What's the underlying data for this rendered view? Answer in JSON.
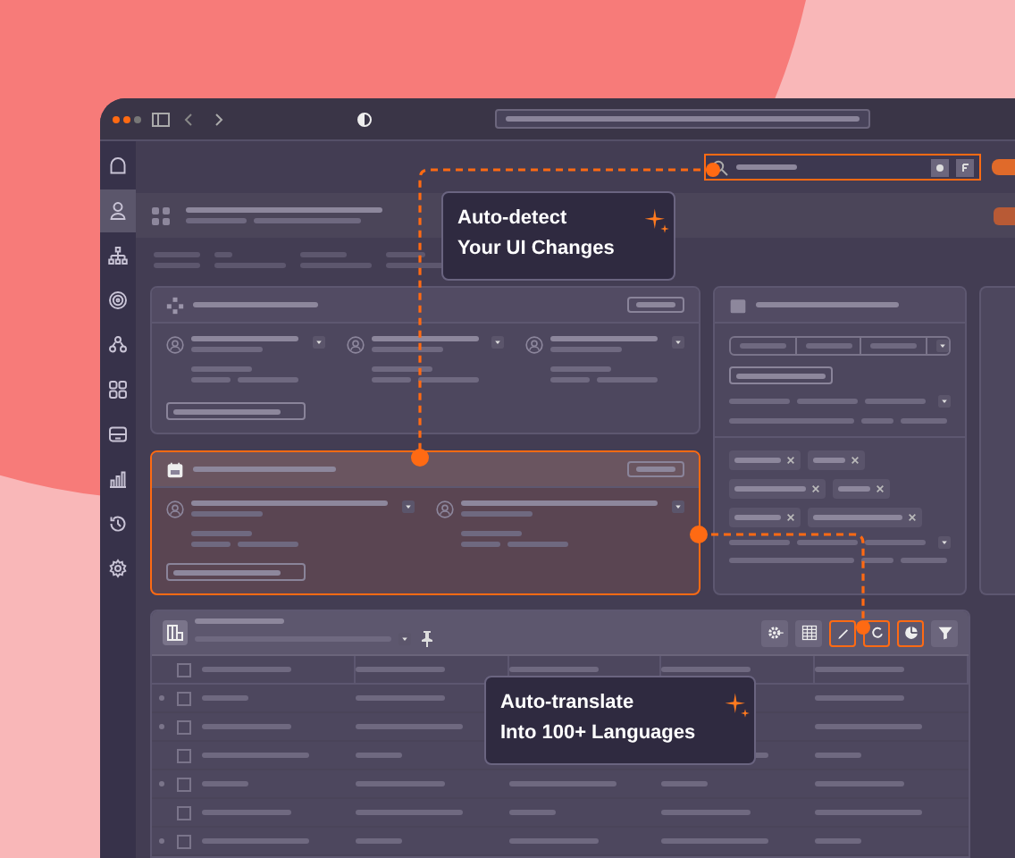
{
  "sidebar": {
    "items": [
      {
        "kind": "home",
        "selected": false
      },
      {
        "kind": "person",
        "selected": true
      },
      {
        "kind": "hierarchy",
        "selected": false
      },
      {
        "kind": "fingerprint",
        "selected": false
      },
      {
        "kind": "group",
        "selected": false
      },
      {
        "kind": "apps",
        "selected": false
      },
      {
        "kind": "archive",
        "selected": false
      },
      {
        "kind": "chart",
        "selected": false
      },
      {
        "kind": "history",
        "selected": false
      },
      {
        "kind": "settings",
        "selected": false
      }
    ]
  },
  "search": {
    "highlighted": true
  },
  "cards": [
    {
      "kind": "three-column",
      "highlighted": false
    },
    {
      "kind": "two-column",
      "highlighted": true
    }
  ],
  "toolbar": {
    "buttons": [
      {
        "kind": "gear",
        "highlighted": false
      },
      {
        "kind": "grid",
        "highlighted": false
      },
      {
        "kind": "pencil",
        "highlighted": true
      },
      {
        "kind": "refresh",
        "highlighted": true
      },
      {
        "kind": "pie",
        "highlighted": true
      },
      {
        "kind": "filter",
        "highlighted": false
      }
    ]
  },
  "table": {
    "header": {
      "checked": false
    },
    "rows": [
      {
        "checked": false,
        "dot": true
      },
      {
        "checked": false,
        "dot": true
      },
      {
        "checked": false,
        "dot": false
      },
      {
        "checked": false,
        "dot": true
      },
      {
        "checked": false,
        "dot": false
      },
      {
        "checked": false,
        "dot": true
      }
    ]
  },
  "callouts": [
    {
      "lines": [
        "Auto-detect",
        "Your UI Changes"
      ]
    },
    {
      "lines": [
        "Auto-translate",
        "Into 100+ Languages"
      ]
    }
  ]
}
